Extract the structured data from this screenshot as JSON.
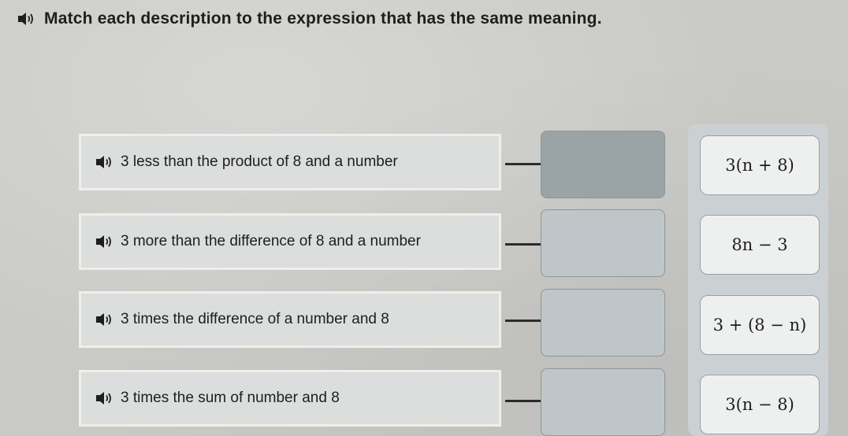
{
  "instructions": {
    "text": "Match each description to the expression that has the same meaning."
  },
  "descriptions": [
    {
      "label": "3 less than the product of 8 and a number"
    },
    {
      "label": "3 more than the difference of 8 and a number"
    },
    {
      "label": "3 times the difference of a number and 8"
    },
    {
      "label": "3 times the sum of number and 8"
    }
  ],
  "expressions": [
    {
      "text": "3(n + 8)"
    },
    {
      "text": "8n − 3"
    },
    {
      "text": "3 + (8 − n)"
    },
    {
      "text": "3(n − 8)"
    }
  ],
  "icons": {
    "audio": "speaker-icon"
  },
  "colors": {
    "background": "#c9c9c6",
    "description_card": "#dcdedd",
    "drop_slot_dark": "#9aa3a6",
    "drop_slot_light": "#bfc6c9",
    "expression_card": "#eef0ef"
  }
}
